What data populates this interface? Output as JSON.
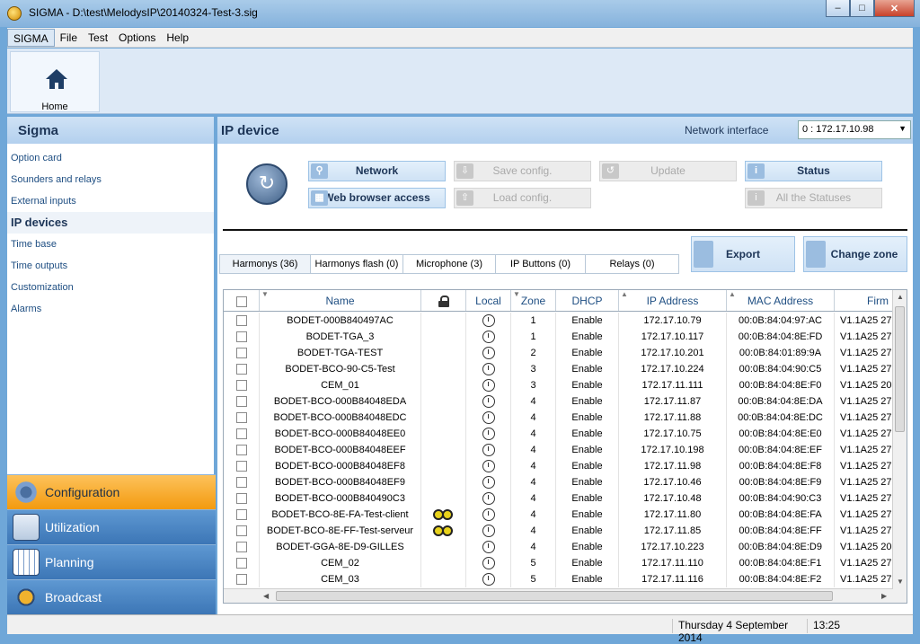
{
  "window": {
    "title": "SIGMA - D:\\test\\MelodysIP\\20140324-Test-3.sig",
    "minimize_icon": "minimize-icon",
    "maximize_icon": "maximize-icon",
    "close_icon": "close-icon"
  },
  "menu": {
    "items": [
      "SIGMA",
      "File",
      "Test",
      "Options",
      "Help"
    ]
  },
  "ribbon": {
    "home_label": "Home",
    "home_icon": "house-icon"
  },
  "sidebar": {
    "title": "Sigma",
    "items": [
      "Option card",
      "Sounders and relays",
      "External inputs",
      "IP devices",
      "Time base",
      "Time outputs",
      "Customization",
      "Alarms"
    ],
    "selected": "IP devices",
    "nav": [
      {
        "label": "Configuration",
        "icon": "gears-icon",
        "active": true
      },
      {
        "label": "Utilization",
        "icon": "computer-icon",
        "active": false
      },
      {
        "label": "Planning",
        "icon": "calendar-icon",
        "active": false
      },
      {
        "label": "Broadcast",
        "icon": "broadcast-icon",
        "active": false
      }
    ]
  },
  "main": {
    "title": "IP device",
    "network_interface_label": "Network interface",
    "network_interface_value": "0 : 172.17.10.98",
    "buttons": {
      "network": "Network",
      "web_browser": "Web browser access",
      "save_config": "Save config.",
      "load_config": "Load config.",
      "update": "Update",
      "status": "Status",
      "all_statuses": "All the Statuses",
      "export": "Export",
      "change_zone": "Change zone"
    },
    "tabs": [
      "Harmonys (36)",
      "Harmonys flash (0)",
      "Microphone (3)",
      "IP Buttons (0)",
      "Relays (0)"
    ],
    "columns": [
      "Name",
      "Local",
      "Zone",
      "DHCP",
      "IP Address",
      "MAC Address",
      "Firm"
    ],
    "rows": [
      {
        "name": "BODET-000B840497AC",
        "link": false,
        "zone": "1",
        "dhcp": "Enable",
        "ip": "172.17.10.79",
        "mac": "00:0B:84:04:97:AC",
        "firm": "V1.1A25  27"
      },
      {
        "name": "BODET-TGA_3",
        "link": false,
        "zone": "1",
        "dhcp": "Enable",
        "ip": "172.17.10.117",
        "mac": "00:0B:84:04:8E:FD",
        "firm": "V1.1A25  27"
      },
      {
        "name": "BODET-TGA-TEST",
        "link": false,
        "zone": "2",
        "dhcp": "Enable",
        "ip": "172.17.10.201",
        "mac": "00:0B:84:01:89:9A",
        "firm": "V1.1A25  27"
      },
      {
        "name": "BODET-BCO-90-C5-Test",
        "link": false,
        "zone": "3",
        "dhcp": "Enable",
        "ip": "172.17.10.224",
        "mac": "00:0B:84:04:90:C5",
        "firm": "V1.1A25  27"
      },
      {
        "name": "CEM_01",
        "link": false,
        "zone": "3",
        "dhcp": "Enable",
        "ip": "172.17.11.111",
        "mac": "00:0B:84:04:8E:F0",
        "firm": "V1.1A25  20"
      },
      {
        "name": "BODET-BCO-000B84048EDA",
        "link": false,
        "zone": "4",
        "dhcp": "Enable",
        "ip": "172.17.11.87",
        "mac": "00:0B:84:04:8E:DA",
        "firm": "V1.1A25  27"
      },
      {
        "name": "BODET-BCO-000B84048EDC",
        "link": false,
        "zone": "4",
        "dhcp": "Enable",
        "ip": "172.17.11.88",
        "mac": "00:0B:84:04:8E:DC",
        "firm": "V1.1A25  27"
      },
      {
        "name": "BODET-BCO-000B84048EE0",
        "link": false,
        "zone": "4",
        "dhcp": "Enable",
        "ip": "172.17.10.75",
        "mac": "00:0B:84:04:8E:E0",
        "firm": "V1.1A25  27"
      },
      {
        "name": "BODET-BCO-000B84048EEF",
        "link": false,
        "zone": "4",
        "dhcp": "Enable",
        "ip": "172.17.10.198",
        "mac": "00:0B:84:04:8E:EF",
        "firm": "V1.1A25  27"
      },
      {
        "name": "BODET-BCO-000B84048EF8",
        "link": false,
        "zone": "4",
        "dhcp": "Enable",
        "ip": "172.17.11.98",
        "mac": "00:0B:84:04:8E:F8",
        "firm": "V1.1A25  27"
      },
      {
        "name": "BODET-BCO-000B84048EF9",
        "link": false,
        "zone": "4",
        "dhcp": "Enable",
        "ip": "172.17.10.46",
        "mac": "00:0B:84:04:8E:F9",
        "firm": "V1.1A25  27"
      },
      {
        "name": "BODET-BCO-000B840490C3",
        "link": false,
        "zone": "4",
        "dhcp": "Enable",
        "ip": "172.17.10.48",
        "mac": "00:0B:84:04:90:C3",
        "firm": "V1.1A25  27"
      },
      {
        "name": "BODET-BCO-8E-FA-Test-client",
        "link": true,
        "zone": "4",
        "dhcp": "Enable",
        "ip": "172.17.11.80",
        "mac": "00:0B:84:04:8E:FA",
        "firm": "V1.1A25  27"
      },
      {
        "name": "BODET-BCO-8E-FF-Test-serveur",
        "link": true,
        "zone": "4",
        "dhcp": "Enable",
        "ip": "172.17.11.85",
        "mac": "00:0B:84:04:8E:FF",
        "firm": "V1.1A25  27"
      },
      {
        "name": "BODET-GGA-8E-D9-GILLES",
        "link": false,
        "zone": "4",
        "dhcp": "Enable",
        "ip": "172.17.10.223",
        "mac": "00:0B:84:04:8E:D9",
        "firm": "V1.1A25  20"
      },
      {
        "name": "CEM_02",
        "link": false,
        "zone": "5",
        "dhcp": "Enable",
        "ip": "172.17.11.110",
        "mac": "00:0B:84:04:8E:F1",
        "firm": "V1.1A25  27"
      },
      {
        "name": "CEM_03",
        "link": false,
        "zone": "5",
        "dhcp": "Enable",
        "ip": "172.17.11.116",
        "mac": "00:0B:84:04:8E:F2",
        "firm": "V1.1A25  27"
      }
    ]
  },
  "statusbar": {
    "date": "Thursday 4 September 2014",
    "time": "13:25"
  },
  "colors": {
    "accent": "#6fa7d8",
    "header": "#1d3557",
    "active_nav": "#f39a0f"
  }
}
